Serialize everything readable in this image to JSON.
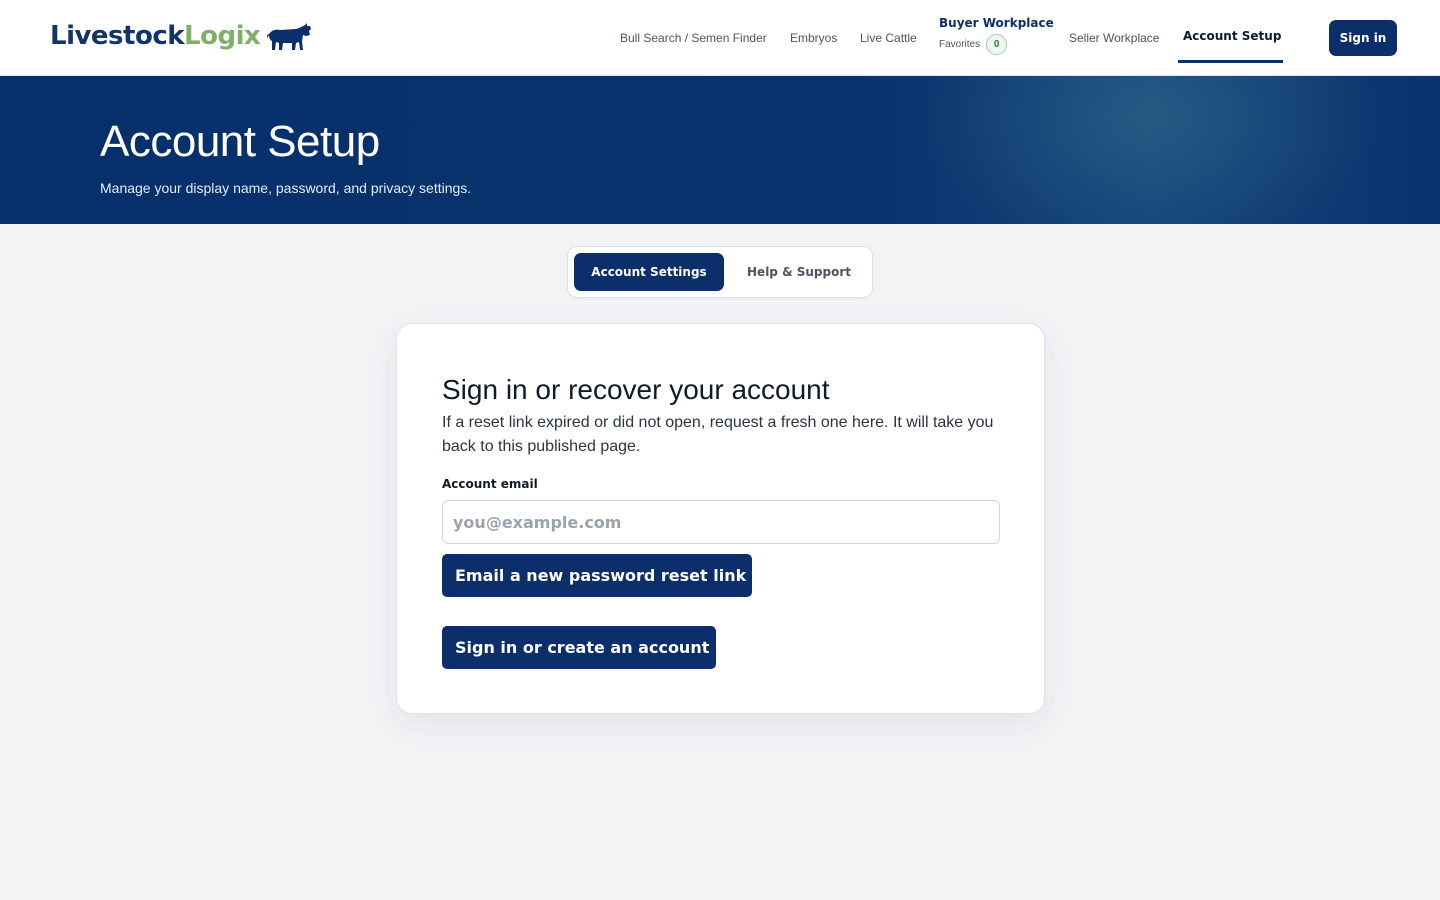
{
  "brand": {
    "name_part1": "Livestock",
    "name_part2": "Logix"
  },
  "nav": {
    "bull_search": "Bull Search / Semen Finder",
    "embryos": "Embryos",
    "live_cattle": "Live Cattle",
    "buyer_workplace": "Buyer Workplace",
    "favorites_label": "Favorites",
    "favorites_count": "0",
    "seller_workplace": "Seller Workplace",
    "account_setup": "Account Setup",
    "sign_in": "Sign in"
  },
  "hero": {
    "title": "Account Setup",
    "subtitle": "Manage your display name, password, and privacy settings."
  },
  "tabs": {
    "account_settings": "Account Settings",
    "help_support": "Help & Support"
  },
  "card": {
    "heading": "Sign in or recover your account",
    "description": "If a reset link expired or did not open, request a fresh one here. It will take you back to this published page.",
    "email_label": "Account email",
    "email_placeholder": "you@example.com",
    "email_value": "",
    "reset_button": "Email a new password reset link",
    "create_button": "Sign in or create an account"
  },
  "colors": {
    "primary": "#0c2f6b",
    "brand_green": "#7fb069",
    "background": "#f2f3f5"
  },
  "icons": {
    "logo_mark": "bull-icon"
  }
}
